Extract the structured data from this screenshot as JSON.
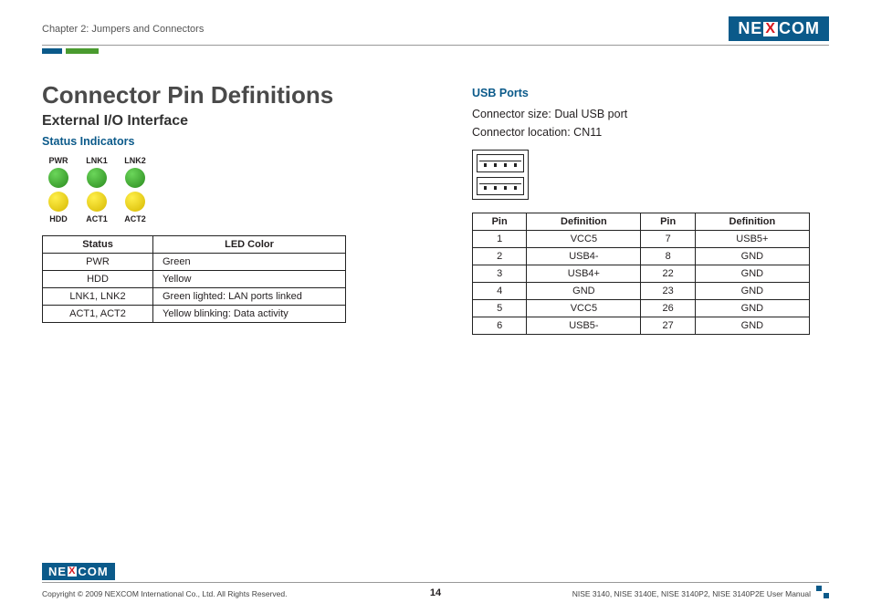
{
  "header": {
    "chapter": "Chapter 2: Jumpers and Connectors",
    "logo_left": "NE",
    "logo_x": "X",
    "logo_right": "COM"
  },
  "left": {
    "h1": "Connector Pin Definitions",
    "h2": "External I/O Interface",
    "h3": "Status Indicators",
    "led_top": [
      "PWR",
      "LNK1",
      "LNK2"
    ],
    "led_bottom": [
      "HDD",
      "ACT1",
      "ACT2"
    ],
    "status_table": {
      "headers": [
        "Status",
        "LED Color"
      ],
      "rows": [
        [
          "PWR",
          "Green"
        ],
        [
          "HDD",
          "Yellow"
        ],
        [
          "LNK1, LNK2",
          "Green lighted: LAN ports linked"
        ],
        [
          "ACT1, ACT2",
          "Yellow blinking: Data activity"
        ]
      ]
    }
  },
  "right": {
    "h3": "USB Ports",
    "line1": "Connector size: Dual USB port",
    "line2": "Connector location: CN11",
    "pin_headers": [
      "Pin",
      "Definition",
      "Pin",
      "Definition"
    ],
    "pin_rows": [
      [
        "1",
        "VCC5",
        "7",
        "USB5+"
      ],
      [
        "2",
        "USB4-",
        "8",
        "GND"
      ],
      [
        "3",
        "USB4+",
        "22",
        "GND"
      ],
      [
        "4",
        "GND",
        "23",
        "GND"
      ],
      [
        "5",
        "VCC5",
        "26",
        "GND"
      ],
      [
        "6",
        "USB5-",
        "27",
        "GND"
      ]
    ]
  },
  "footer": {
    "copyright": "Copyright © 2009 NEXCOM International Co., Ltd. All Rights Reserved.",
    "page": "14",
    "manual": "NISE 3140, NISE 3140E, NISE 3140P2, NISE 3140P2E User Manual"
  }
}
